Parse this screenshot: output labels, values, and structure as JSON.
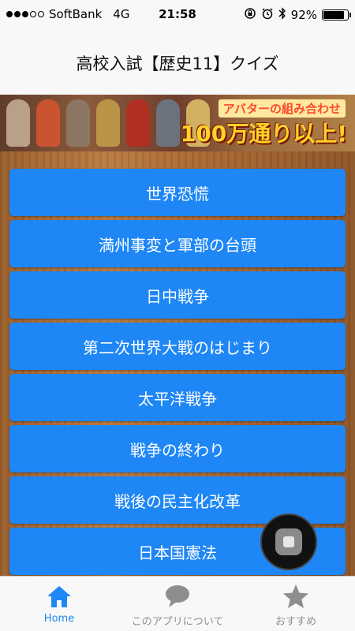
{
  "status_bar": {
    "signal_dots_filled": 3,
    "signal_dots_total": 5,
    "carrier": "SoftBank",
    "network": "4G",
    "time": "21:58",
    "battery": "92%",
    "battery_level": 0.92
  },
  "nav": {
    "title": "高校入試【歴史11】クイズ"
  },
  "banner": {
    "line1": "アバターの組み合わせ",
    "line2": "100万通り以上!"
  },
  "topics": [
    {
      "label": "世界恐慌"
    },
    {
      "label": "満州事変と軍部の台頭"
    },
    {
      "label": "日中戦争"
    },
    {
      "label": "第二次世界大戦のはじまり"
    },
    {
      "label": "太平洋戦争"
    },
    {
      "label": "戦争の終わり"
    },
    {
      "label": "戦後の民主化改革"
    },
    {
      "label": "日本国憲法"
    }
  ],
  "tab_bar": {
    "tabs": [
      {
        "label": "Home",
        "icon": "home-icon",
        "active": true
      },
      {
        "label": "このアプリについて",
        "icon": "speech-bubble-icon",
        "active": false
      },
      {
        "label": "おすすめ",
        "icon": "star-icon",
        "active": false
      }
    ]
  },
  "colors": {
    "accent": "#1e87f5",
    "tab_inactive": "#8e8e8e",
    "button_text": "#ffffff"
  }
}
